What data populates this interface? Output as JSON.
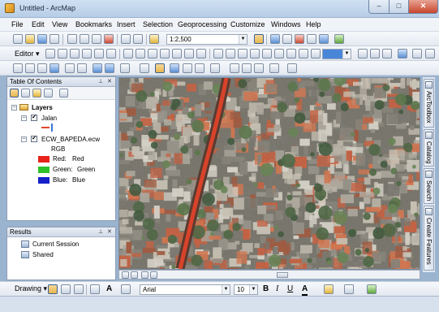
{
  "window": {
    "title": "Untitled - ArcMap",
    "min": "–",
    "max": "□",
    "close": "✕"
  },
  "menu": [
    "File",
    "Edit",
    "View",
    "Bookmarks",
    "Insert",
    "Selection",
    "Geoprocessing",
    "Customize",
    "Windows",
    "Help"
  ],
  "standard_toolbar": {
    "scale_value": "1:2,500"
  },
  "editor_toolbar": {
    "editor_label": "Editor ▾"
  },
  "toc": {
    "title": "Table Of Contents",
    "pin": "⊥",
    "close": "✕",
    "layers_group": "Layers",
    "layer1_name": "Jalan",
    "layer2_name": "ECW_BAPEDA.ecw",
    "rgb_label": "RGB",
    "bands": [
      {
        "label": "Red:",
        "value": "Red",
        "color": "#e8231b"
      },
      {
        "label": "Green:",
        "value": "Green",
        "color": "#2ec12a"
      },
      {
        "label": "Blue:",
        "value": "Blue",
        "color": "#1620c8"
      }
    ],
    "jalan_symbol_color": "#e5442a"
  },
  "results": {
    "title": "Results",
    "items": [
      "Current Session",
      "Shared"
    ]
  },
  "dock_tabs": [
    "ArcToolbox",
    "Catalog",
    "Search",
    "Create Features"
  ],
  "draw_toolbar": {
    "drawing_label": "Drawing ▾",
    "font_name": "Arial",
    "font_size": "10",
    "bold": "B",
    "italic": "I",
    "underline": "U",
    "font_color_letter": "A"
  },
  "colors": {
    "road": "#d8432a",
    "road_edge": "#6b3b2a",
    "roof_red": "#c4532f",
    "vegetation": "#3d5a32"
  }
}
